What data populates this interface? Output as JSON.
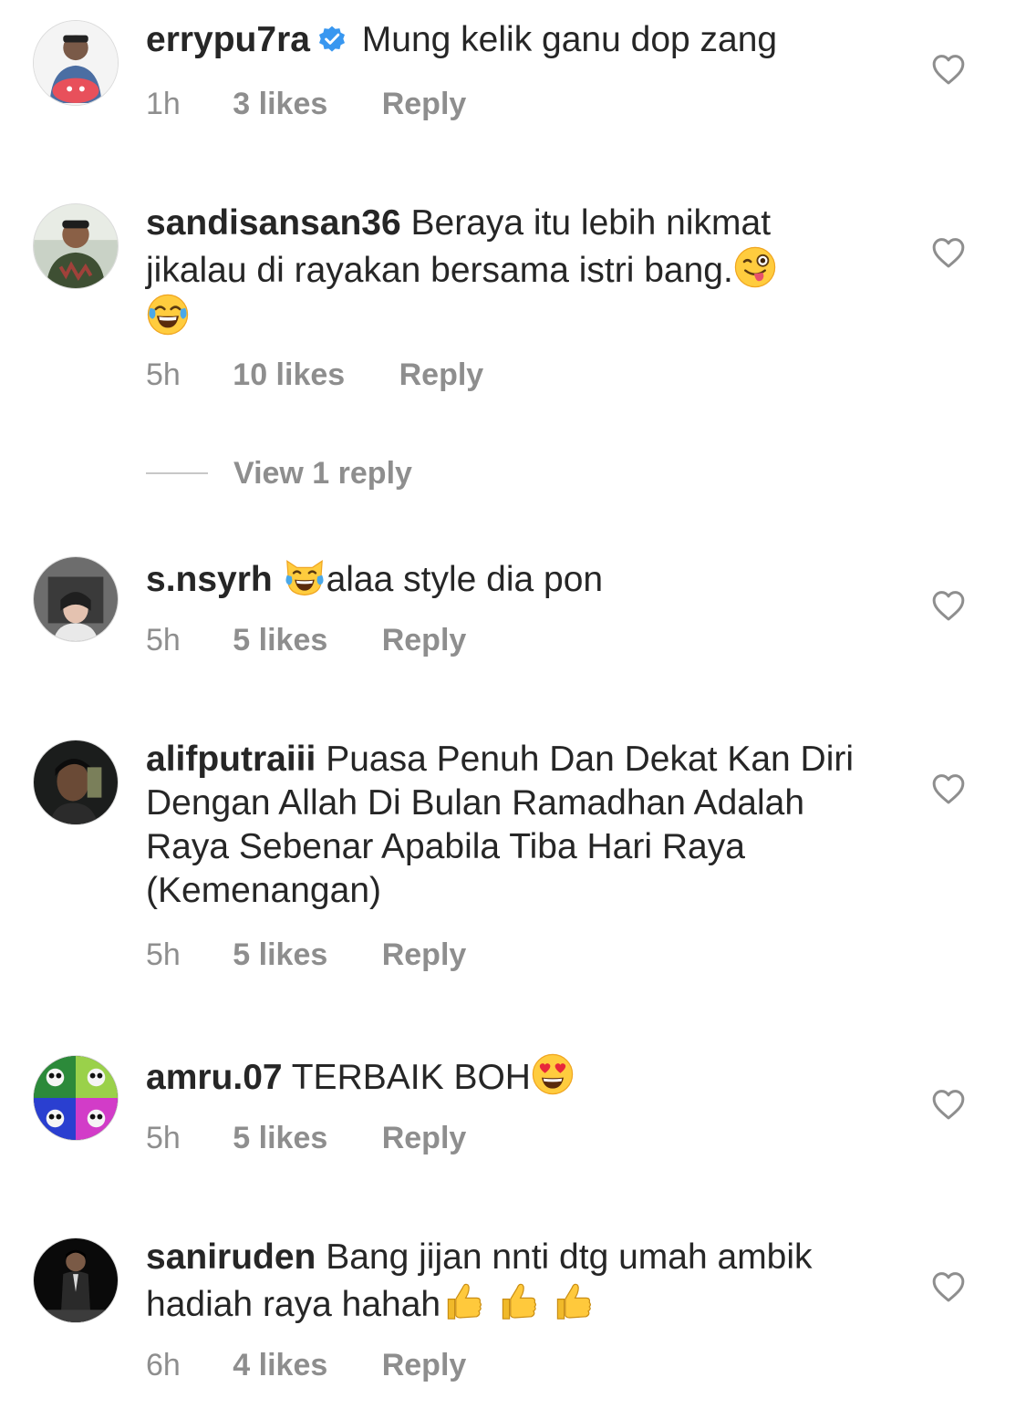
{
  "comments": [
    {
      "username": "errypu7ra",
      "verified": true,
      "text": "Mung kelik ganu dop zang",
      "time": "1h",
      "likes": "3 likes",
      "reply": "Reply"
    },
    {
      "username": "sandisansan36",
      "verified": false,
      "text": "Beraya itu lebih nikmat jikalau di rayakan bersama istri bang.",
      "time": "5h",
      "likes": "10 likes",
      "reply": "Reply"
    },
    {
      "username": "s.nsyrh",
      "verified": false,
      "text": "alaa style dia pon",
      "time": "5h",
      "likes": "5 likes",
      "reply": "Reply"
    },
    {
      "username": "alifputraiii",
      "verified": false,
      "text": "Puasa Penuh Dan Dekat Kan Diri Dengan Allah Di Bulan Ramadhan Adalah Raya Sebenar Apabila Tiba Hari Raya (Kemenangan)",
      "time": "5h",
      "likes": "5 likes",
      "reply": "Reply"
    },
    {
      "username": "amru.07",
      "verified": false,
      "text": "TERBAIK BOH",
      "time": "5h",
      "likes": "5 likes",
      "reply": "Reply"
    },
    {
      "username": "saniruden",
      "verified": false,
      "text": "Bang jijan nnti dtg umah ambik hadiah raya hahah",
      "time": "6h",
      "likes": "4 likes",
      "reply": "Reply"
    }
  ],
  "view_replies": "View 1 reply",
  "icons": {
    "like": "heart-outline-icon",
    "verified": "verified-badge-icon",
    "emoji_wink_tongue": "winking-face-with-tongue",
    "emoji_tears_of_joy": "face-with-tears-of-joy",
    "emoji_cat_tears_of_joy": "cat-with-tears-of-joy",
    "emoji_heart_eyes": "smiling-face-with-heart-eyes",
    "emoji_thumbs_up": "thumbs-up"
  },
  "colors": {
    "text": "#262626",
    "secondary": "#8e8e8e",
    "verified": "#3897f0"
  }
}
